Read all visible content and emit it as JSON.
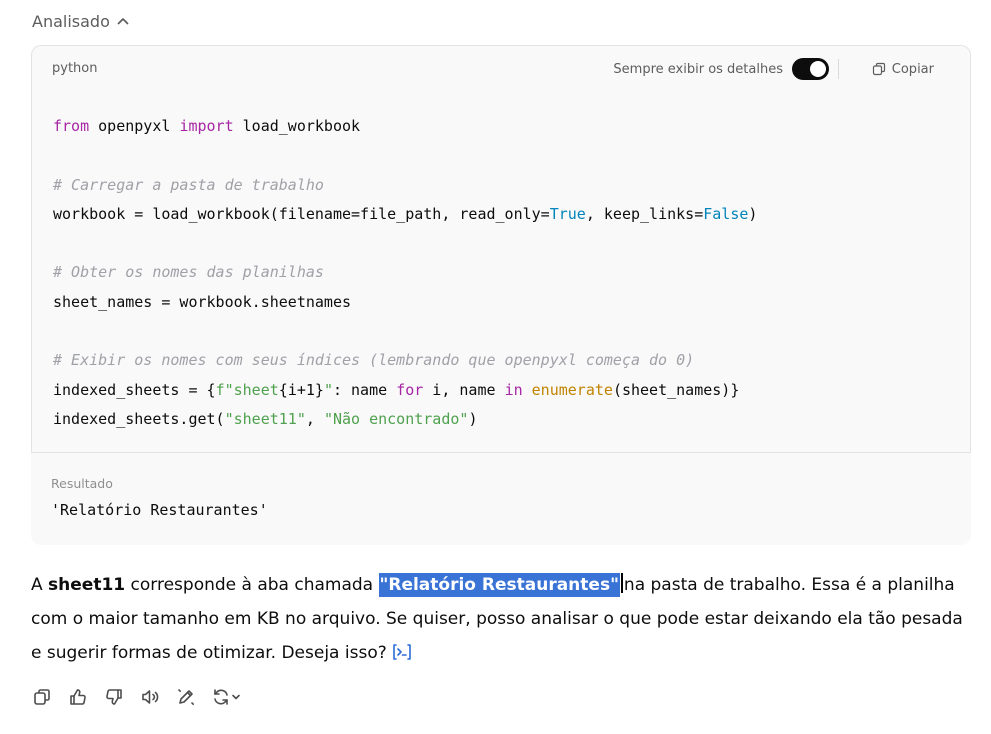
{
  "analyzed_label": "Analisado",
  "code_block": {
    "language": "python",
    "toggle_label": "Sempre exibir os detalhes",
    "toggle_on": true,
    "copy_label": "Copiar",
    "lines": [
      "from openpyxl import load_workbook",
      "",
      "# Carregar a pasta de trabalho",
      "workbook = load_workbook(filename=file_path, read_only=True, keep_links=False)",
      "",
      "# Obter os nomes das planilhas",
      "sheet_names = workbook.sheetnames",
      "",
      "# Exibir os nomes com seus índices (lembrando que openpyxl começa do 0)",
      "indexed_sheets = {f\"sheet{i+1}\": name for i, name in enumerate(sheet_names)}",
      "indexed_sheets.get(\"sheet11\", \"Não encontrado\")"
    ]
  },
  "result": {
    "label": "Resultado",
    "value": "'Relatório Restaurantes'"
  },
  "answer": {
    "prefix": "A ",
    "bold_term": "sheet11",
    "mid": " corresponde à aba chamada ",
    "highlighted": "\"Relatório Restaurantes\"",
    "suffix": "na pasta de trabalho. Essa é a planilha com o maior tamanho em KB no arquivo. Se quiser, posso analisar o que pode estar deixando ela tão pesada e sugerir formas de otimizar. Deseja isso?"
  },
  "actions": [
    {
      "name": "copy-icon"
    },
    {
      "name": "thumbs-up-icon"
    },
    {
      "name": "thumbs-down-icon"
    },
    {
      "name": "read-aloud-icon"
    },
    {
      "name": "edit-canvas-icon"
    },
    {
      "name": "regenerate-icon"
    }
  ]
}
